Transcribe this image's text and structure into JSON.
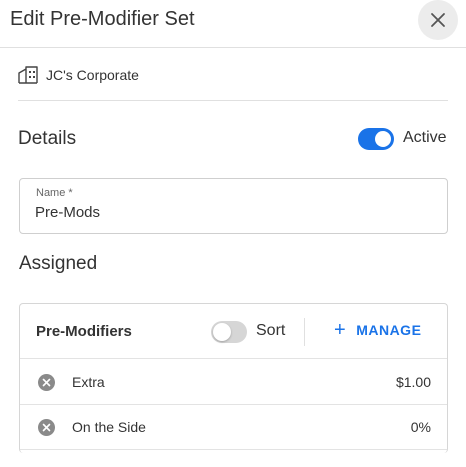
{
  "header": {
    "title": "Edit Pre-Modifier Set",
    "close_icon": "close-icon"
  },
  "org": {
    "icon": "building-icon",
    "name": "JC's Corporate"
  },
  "details": {
    "title": "Details",
    "active_label": "Active",
    "active_on": true,
    "accent_color": "#1a73e8"
  },
  "name_field": {
    "label": "Name *",
    "value": "Pre-Mods"
  },
  "assigned": {
    "title": "Assigned",
    "card_title": "Pre-Modifiers",
    "sort_label": "Sort",
    "sort_on": false,
    "manage_label": "MANAGE",
    "items": [
      {
        "name": "Extra",
        "price": "$1.00"
      },
      {
        "name": "On the Side",
        "price": "0%"
      }
    ]
  }
}
